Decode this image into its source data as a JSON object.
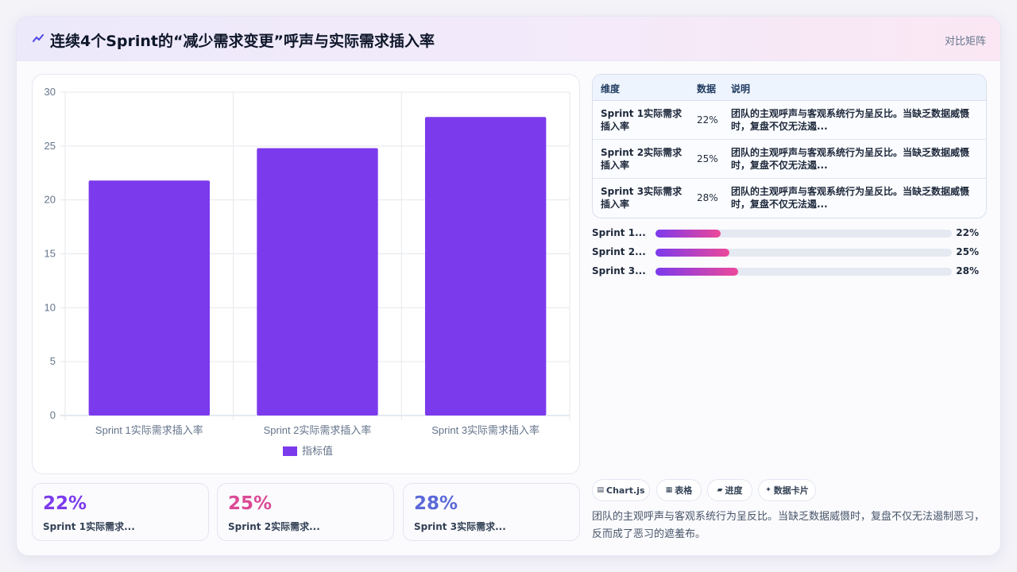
{
  "header": {
    "title": "连续4个Sprint的“减少需求变更”呼声与实际需求插入率",
    "tag": "对比矩阵"
  },
  "chart_data": {
    "type": "bar",
    "categories": [
      "Sprint 1实际需求插入率",
      "Sprint 2实际需求插入率",
      "Sprint 3实际需求插入率"
    ],
    "series": [
      {
        "name": "指标值",
        "values": [
          21.8,
          24.8,
          27.7
        ]
      }
    ],
    "ylim": [
      0,
      30
    ],
    "yticks": [
      "0",
      "5",
      "10",
      "15",
      "20",
      "25",
      "30"
    ],
    "legend": "bottom",
    "grid": true,
    "bar_color": "#7c3aed"
  },
  "stats": [
    {
      "value": "22%",
      "label": "Sprint 1实际需求...",
      "color": "#7c3aed"
    },
    {
      "value": "25%",
      "label": "Sprint 2实际需求...",
      "color": "#db4a95"
    },
    {
      "value": "28%",
      "label": "Sprint 3实际需求...",
      "color": "#5b6ad8"
    }
  ],
  "table": {
    "headers": [
      "维度",
      "数据",
      "说明"
    ],
    "rows": [
      {
        "dim": "Sprint 1实际需求插入率",
        "value": "22%",
        "desc": "团队的主观呼声与客观系统行为呈反比。当缺乏数据威慑时，复盘不仅无法遏..."
      },
      {
        "dim": "Sprint 2实际需求插入率",
        "value": "25%",
        "desc": "团队的主观呼声与客观系统行为呈反比。当缺乏数据威慑时，复盘不仅无法遏..."
      },
      {
        "dim": "Sprint 3实际需求插入率",
        "value": "28%",
        "desc": "团队的主观呼声与客观系统行为呈反比。当缺乏数据威慑时，复盘不仅无法遏..."
      }
    ]
  },
  "progress": [
    {
      "label": "Sprint 1...",
      "value": "22%",
      "fraction": 0.22
    },
    {
      "label": "Sprint 2...",
      "value": "25%",
      "fraction": 0.25
    },
    {
      "label": "Sprint 3...",
      "value": "28%",
      "fraction": 0.28
    }
  ],
  "chips": [
    {
      "icon": "chart-icon",
      "glyph": "▤",
      "label": "Chart.js"
    },
    {
      "icon": "table-icon",
      "glyph": "▦",
      "label": "表格"
    },
    {
      "icon": "progress-icon",
      "glyph": "▰",
      "label": "进度"
    },
    {
      "icon": "sparkle-icon",
      "glyph": "✦",
      "label": "数据卡片"
    }
  ],
  "summary": "团队的主观呼声与客观系统行为呈反比。当缺乏数据威慑时，复盘不仅无法遏制恶习，反而成了恶习的遮羞布。"
}
